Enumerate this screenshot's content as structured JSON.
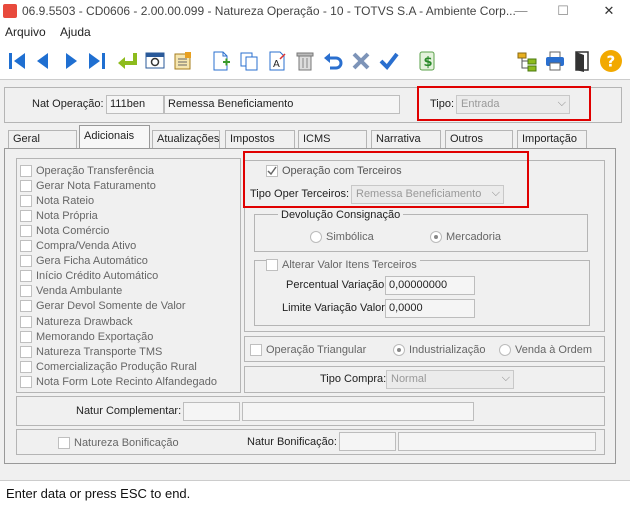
{
  "window": {
    "title": "06.9.5503 - CD0606 - 2.00.00.099 - Natureza Operação - 10 - TOTVS S.A - Ambiente Corp...",
    "minimize": "—",
    "maximize": "☐",
    "close": "✕"
  },
  "menu": {
    "items": [
      "Arquivo",
      "Ajuda"
    ]
  },
  "toolbar": {
    "icons": [
      "first-icon",
      "prev-icon",
      "next-icon",
      "last-icon",
      "goto-icon",
      "search-icon",
      "list-icon",
      "new-icon",
      "copy-icon",
      "rename-icon",
      "delete-icon",
      "undo-icon",
      "cancel-icon",
      "confirm-icon",
      "money-icon",
      "tree-icon",
      "print-icon",
      "exit-icon",
      "help-icon"
    ],
    "money_symbol": "$",
    "help_symbol": "?"
  },
  "header": {
    "nat_operacao_label": "Nat Operação:",
    "nat_operacao_code": "111ben",
    "nat_operacao_desc": "Remessa Beneficiamento",
    "tipo_label": "Tipo:",
    "tipo_value": "Entrada"
  },
  "tabs": [
    "Geral",
    "Adicionais",
    "Atualizações",
    "Impostos",
    "ICMS",
    "Narrativa",
    "Outros",
    "Importação"
  ],
  "active_tab": "Adicionais",
  "left_checks": [
    "Operação Transferência",
    "Gerar Nota Faturamento",
    "Nota Rateio",
    "Nota Própria",
    "Nota Comércio",
    "Compra/Venda Ativo",
    "Gera Ficha Automático",
    "Início Crédito Automático",
    "Venda Ambulante",
    "Gerar Devol Somente de Valor",
    "Natureza Drawback",
    "Memorando Exportação",
    "Natureza Transporte TMS",
    "Comercialização Produção Rural",
    "Nota Form Lote Recinto Alfandegado"
  ],
  "terceiros": {
    "check_label": "Operação com Terceiros",
    "checked": true,
    "tipo_label": "Tipo Oper Terceiros:",
    "tipo_value": "Remessa Beneficiamento"
  },
  "devolucao": {
    "title": "Devolução Consignação",
    "options": [
      "Simbólica",
      "Mercadoria"
    ],
    "selected": "Mercadoria"
  },
  "alterar": {
    "check_label": "Alterar Valor Itens Terceiros",
    "percentual_label": "Percentual Variação:",
    "percentual_value": "0,00000000",
    "limite_label": "Limite Variação Valor:",
    "limite_value": "0,0000"
  },
  "triangular": {
    "check_label": "Operação Triangular",
    "options": [
      "Industrialização",
      "Venda à Ordem"
    ],
    "selected": "Industrialização"
  },
  "compra": {
    "label": "Tipo Compra:",
    "value": "Normal"
  },
  "complementar": {
    "label": "Natur Complementar:"
  },
  "bonificacao": {
    "check_label": "Natureza Bonificação",
    "label": "Natur Bonificação:"
  },
  "status": {
    "text": "Enter data or press ESC to end."
  },
  "colors": {
    "highlight": "#e00000",
    "accent": "#1f6fd1"
  }
}
